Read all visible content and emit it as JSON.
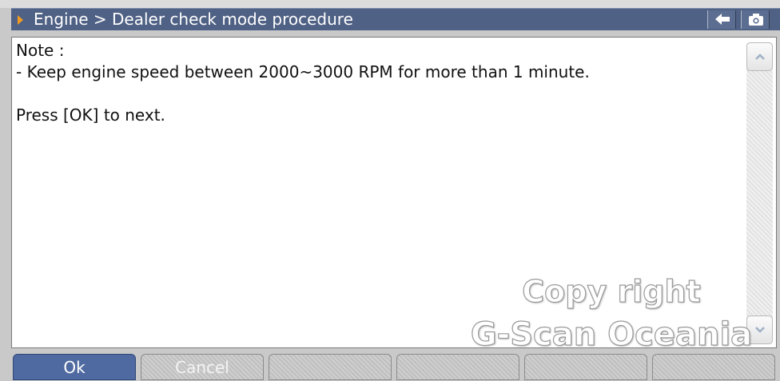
{
  "header": {
    "title": "Engine > Dealer check mode procedure",
    "back_icon": "back-arrow-icon",
    "camera_icon": "camera-icon"
  },
  "content": {
    "lines": [
      "Note :",
      "- Keep engine speed between 2000~3000 RPM for more than 1 minute.",
      "",
      "Press [OK] to next."
    ]
  },
  "buttons": {
    "ok": "Ok",
    "cancel": "Cancel"
  },
  "watermark": {
    "line1": "Copy right",
    "line2": "G-Scan Oceania"
  },
  "colors": {
    "title_bar": "#4f6184",
    "accent_arrow": "#f29b22",
    "primary_button": "#4f6aa0"
  }
}
